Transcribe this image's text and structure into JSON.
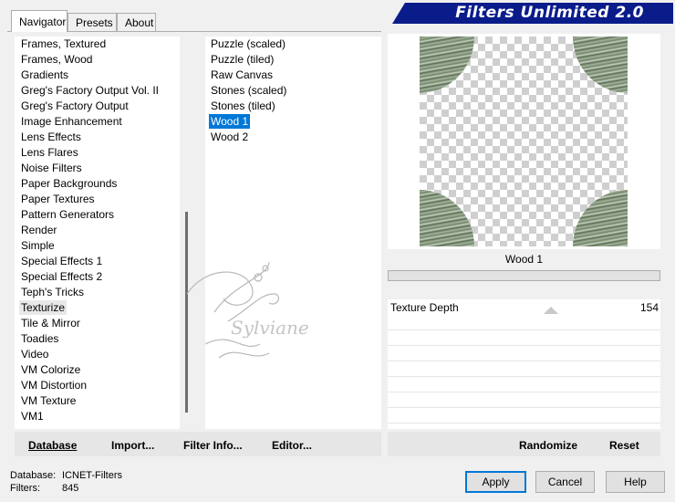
{
  "banner": {
    "title": "Filters Unlimited 2.0"
  },
  "tabs": [
    "Navigator",
    "Presets",
    "About"
  ],
  "categories": [
    "Frames, Textured",
    "Frames, Wood",
    "Gradients",
    "Greg's Factory Output Vol. II",
    "Greg's Factory Output",
    "Image Enhancement",
    "Lens Effects",
    "Lens Flares",
    "Noise Filters",
    "Paper Backgrounds",
    "Paper Textures",
    "Pattern Generators",
    "Render",
    "Simple",
    "Special Effects 1",
    "Special Effects 2",
    "Teph's Tricks",
    "Texturize",
    "Tile & Mirror",
    "Toadies",
    "Video",
    "VM Colorize",
    "VM Distortion",
    "VM Texture",
    "VM1"
  ],
  "categories_current": "Texturize",
  "filters": [
    "Puzzle (scaled)",
    "Puzzle (tiled)",
    "Raw Canvas",
    "Stones (scaled)",
    "Stones (tiled)",
    "Wood 1",
    "Wood 2"
  ],
  "filters_selected": "Wood 1",
  "preview": {
    "filter_name": "Wood 1"
  },
  "params": [
    {
      "label": "Texture Depth",
      "value": "154"
    }
  ],
  "watermark": "Sylviane",
  "left_buttons": {
    "database": "Database",
    "import": "Import...",
    "filter_info": "Filter Info...",
    "editor": "Editor..."
  },
  "right_buttons": {
    "randomize": "Randomize",
    "reset": "Reset"
  },
  "status": {
    "database_label": "Database:",
    "database_value": "ICNET-Filters",
    "filters_label": "Filters:",
    "filters_value": "845"
  },
  "dialog_buttons": {
    "apply": "Apply",
    "cancel": "Cancel",
    "help": "Help"
  }
}
